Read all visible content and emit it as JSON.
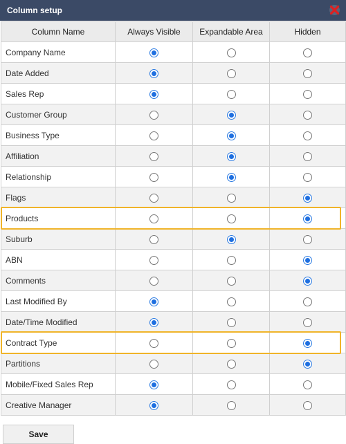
{
  "dialog": {
    "title": "Column setup",
    "close_icon": "close-x-icon",
    "close_color": "#e02020"
  },
  "table": {
    "headers": [
      "Column Name",
      "Always Visible",
      "Expandable Area",
      "Hidden"
    ],
    "options": [
      "always",
      "expandable",
      "hidden"
    ],
    "rows": [
      {
        "name": "Company Name",
        "selected": "always",
        "highlighted": false
      },
      {
        "name": "Date Added",
        "selected": "always",
        "highlighted": false
      },
      {
        "name": "Sales Rep",
        "selected": "always",
        "highlighted": false
      },
      {
        "name": "Customer Group",
        "selected": "expandable",
        "highlighted": false
      },
      {
        "name": "Business Type",
        "selected": "expandable",
        "highlighted": false
      },
      {
        "name": "Affiliation",
        "selected": "expandable",
        "highlighted": false
      },
      {
        "name": "Relationship",
        "selected": "expandable",
        "highlighted": false
      },
      {
        "name": "Flags",
        "selected": "hidden",
        "highlighted": false
      },
      {
        "name": "Products",
        "selected": "hidden",
        "highlighted": true
      },
      {
        "name": "Suburb",
        "selected": "expandable",
        "highlighted": false
      },
      {
        "name": "ABN",
        "selected": "hidden",
        "highlighted": false
      },
      {
        "name": "Comments",
        "selected": "hidden",
        "highlighted": false
      },
      {
        "name": "Last Modified By",
        "selected": "always",
        "highlighted": false
      },
      {
        "name": "Date/Time Modified",
        "selected": "always",
        "highlighted": false
      },
      {
        "name": "Contract Type",
        "selected": "hidden",
        "highlighted": true
      },
      {
        "name": "Partitions",
        "selected": "hidden",
        "highlighted": false
      },
      {
        "name": "Mobile/Fixed Sales Rep",
        "selected": "always",
        "highlighted": false
      },
      {
        "name": "Creative Manager",
        "selected": "always",
        "highlighted": false
      }
    ]
  },
  "footer": {
    "save_label": "Save"
  },
  "colors": {
    "titlebar": "#3b4a66",
    "radio_selected": "#1e6fe0",
    "highlight": "#f0b429"
  }
}
